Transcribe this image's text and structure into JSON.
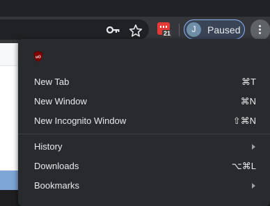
{
  "toolbar": {
    "key_icon": "key-icon",
    "star_icon": "star-icon",
    "extension": {
      "icon": "extension-icon",
      "badge_count": "21"
    },
    "profile": {
      "avatar_initial": "J",
      "status": "Paused",
      "accent": "#8ab4f8"
    },
    "menu_icon": "more-vert-icon"
  },
  "menu": {
    "extension_icon": "ublock-origin-icon",
    "items": [
      {
        "label": "New Tab",
        "shortcut": "⌘T"
      },
      {
        "label": "New Window",
        "shortcut": "⌘N"
      },
      {
        "label": "New Incognito Window",
        "shortcut": "⇧⌘N"
      },
      {
        "label": "History",
        "submenu": true
      },
      {
        "label": "Downloads",
        "shortcut": "⌥⌘L"
      },
      {
        "label": "Bookmarks",
        "submenu": true
      }
    ]
  },
  "colors": {
    "menu_bg": "#292a2d",
    "toolbar_bg": "#35363a",
    "ublock_red": "#800000"
  }
}
